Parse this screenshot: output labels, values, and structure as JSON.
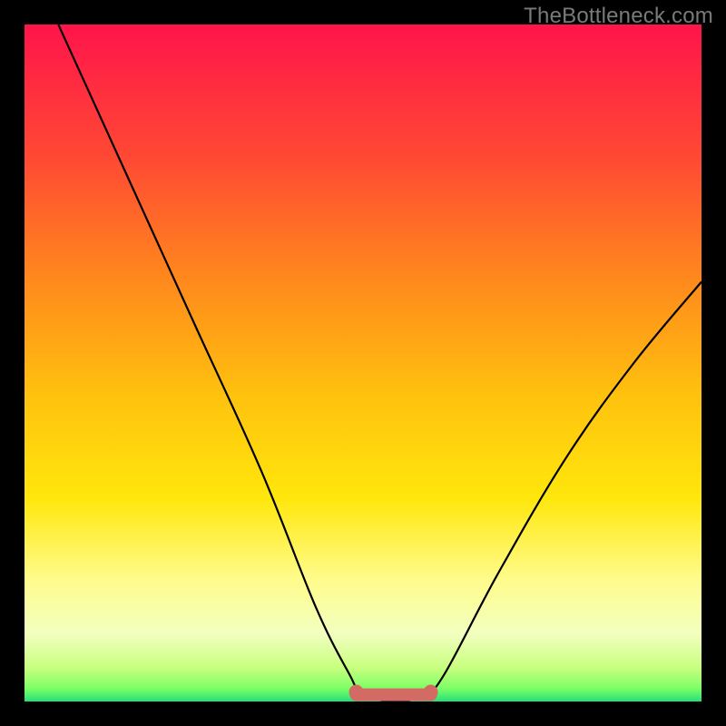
{
  "watermark": "TheBottleneck.com",
  "chart_data": {
    "type": "line",
    "title": "",
    "xlabel": "",
    "ylabel": "",
    "xlim": [
      0,
      100
    ],
    "ylim": [
      0,
      100
    ],
    "series": [
      {
        "name": "curve",
        "color": "#000000",
        "points": [
          {
            "x": 5,
            "y": 100
          },
          {
            "x": 15,
            "y": 78
          },
          {
            "x": 25,
            "y": 56
          },
          {
            "x": 35,
            "y": 34
          },
          {
            "x": 43,
            "y": 14
          },
          {
            "x": 48,
            "y": 4
          },
          {
            "x": 50,
            "y": 1
          },
          {
            "x": 55,
            "y": 0
          },
          {
            "x": 59,
            "y": 1
          },
          {
            "x": 62,
            "y": 4
          },
          {
            "x": 70,
            "y": 19
          },
          {
            "x": 80,
            "y": 36
          },
          {
            "x": 90,
            "y": 50
          },
          {
            "x": 100,
            "y": 62
          }
        ]
      }
    ],
    "highlight_band": {
      "label": "optimal-range",
      "color": "#d46a64",
      "x_from": 49,
      "x_to": 60,
      "y": 1
    },
    "gradient_stops": [
      {
        "pos": 0,
        "color": "#ff144b"
      },
      {
        "pos": 20,
        "color": "#ff4a33"
      },
      {
        "pos": 38,
        "color": "#ff8a1c"
      },
      {
        "pos": 55,
        "color": "#ffc20e"
      },
      {
        "pos": 70,
        "color": "#ffe70c"
      },
      {
        "pos": 82,
        "color": "#fffc8c"
      },
      {
        "pos": 90,
        "color": "#f2ffbf"
      },
      {
        "pos": 95,
        "color": "#c8ff7f"
      },
      {
        "pos": 98,
        "color": "#7fff65"
      },
      {
        "pos": 100,
        "color": "#24e07a"
      }
    ]
  }
}
